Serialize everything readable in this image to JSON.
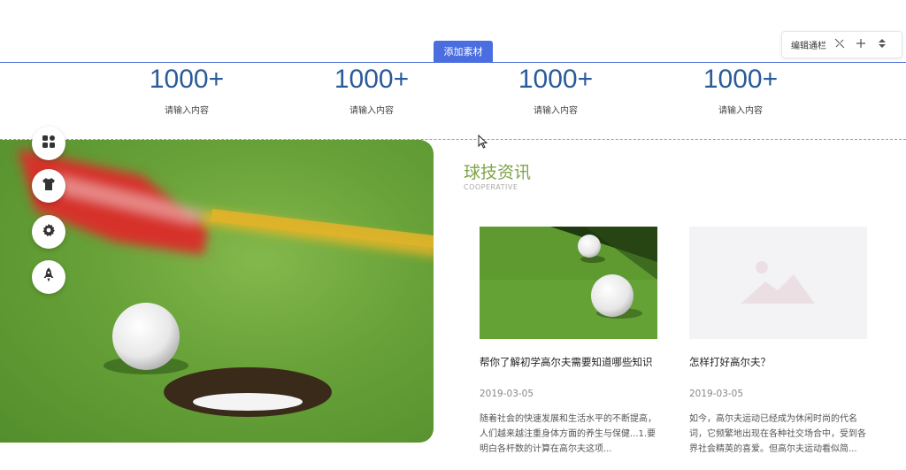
{
  "editor": {
    "add_material_label": "添加素材",
    "toolbar_label": "编辑通栏",
    "toolbar_icons": [
      "unlink-icon",
      "plus-icon",
      "sort-icon"
    ]
  },
  "stats": [
    {
      "value": "1000+",
      "label": "请输入内容"
    },
    {
      "value": "1000+",
      "label": "请输入内容"
    },
    {
      "value": "1000+",
      "label": "请输入内容"
    },
    {
      "value": "1000+",
      "label": "请输入内容"
    }
  ],
  "side_menu": [
    "grid-icon",
    "shirt-icon",
    "gear-icon",
    "rocket-icon"
  ],
  "section": {
    "title": "球技资讯",
    "subtitle": "COOPERATIVE"
  },
  "news": [
    {
      "title": "帮你了解初学高尔夫需要知道哪些知识",
      "date": "2019-03-05",
      "desc": "随着社会的快速发展和生活水平的不断提高，人们越来越注重身体方面的养生与保健...1.要明白各杆数的计算在高尔夫这项..."
    },
    {
      "title": "怎样打好高尔夫？",
      "date": "2019-03-05",
      "desc": "如今，高尔夫运动已经成为休闲时尚的代名词，它频繁地出现在各种社交场合中，受到各界社会精英的喜爱。但高尔夫运动看似简..."
    }
  ],
  "colors": {
    "accent": "#4a6ee0",
    "stat_number": "#2a5b9a",
    "section_title": "#7fa34a"
  }
}
